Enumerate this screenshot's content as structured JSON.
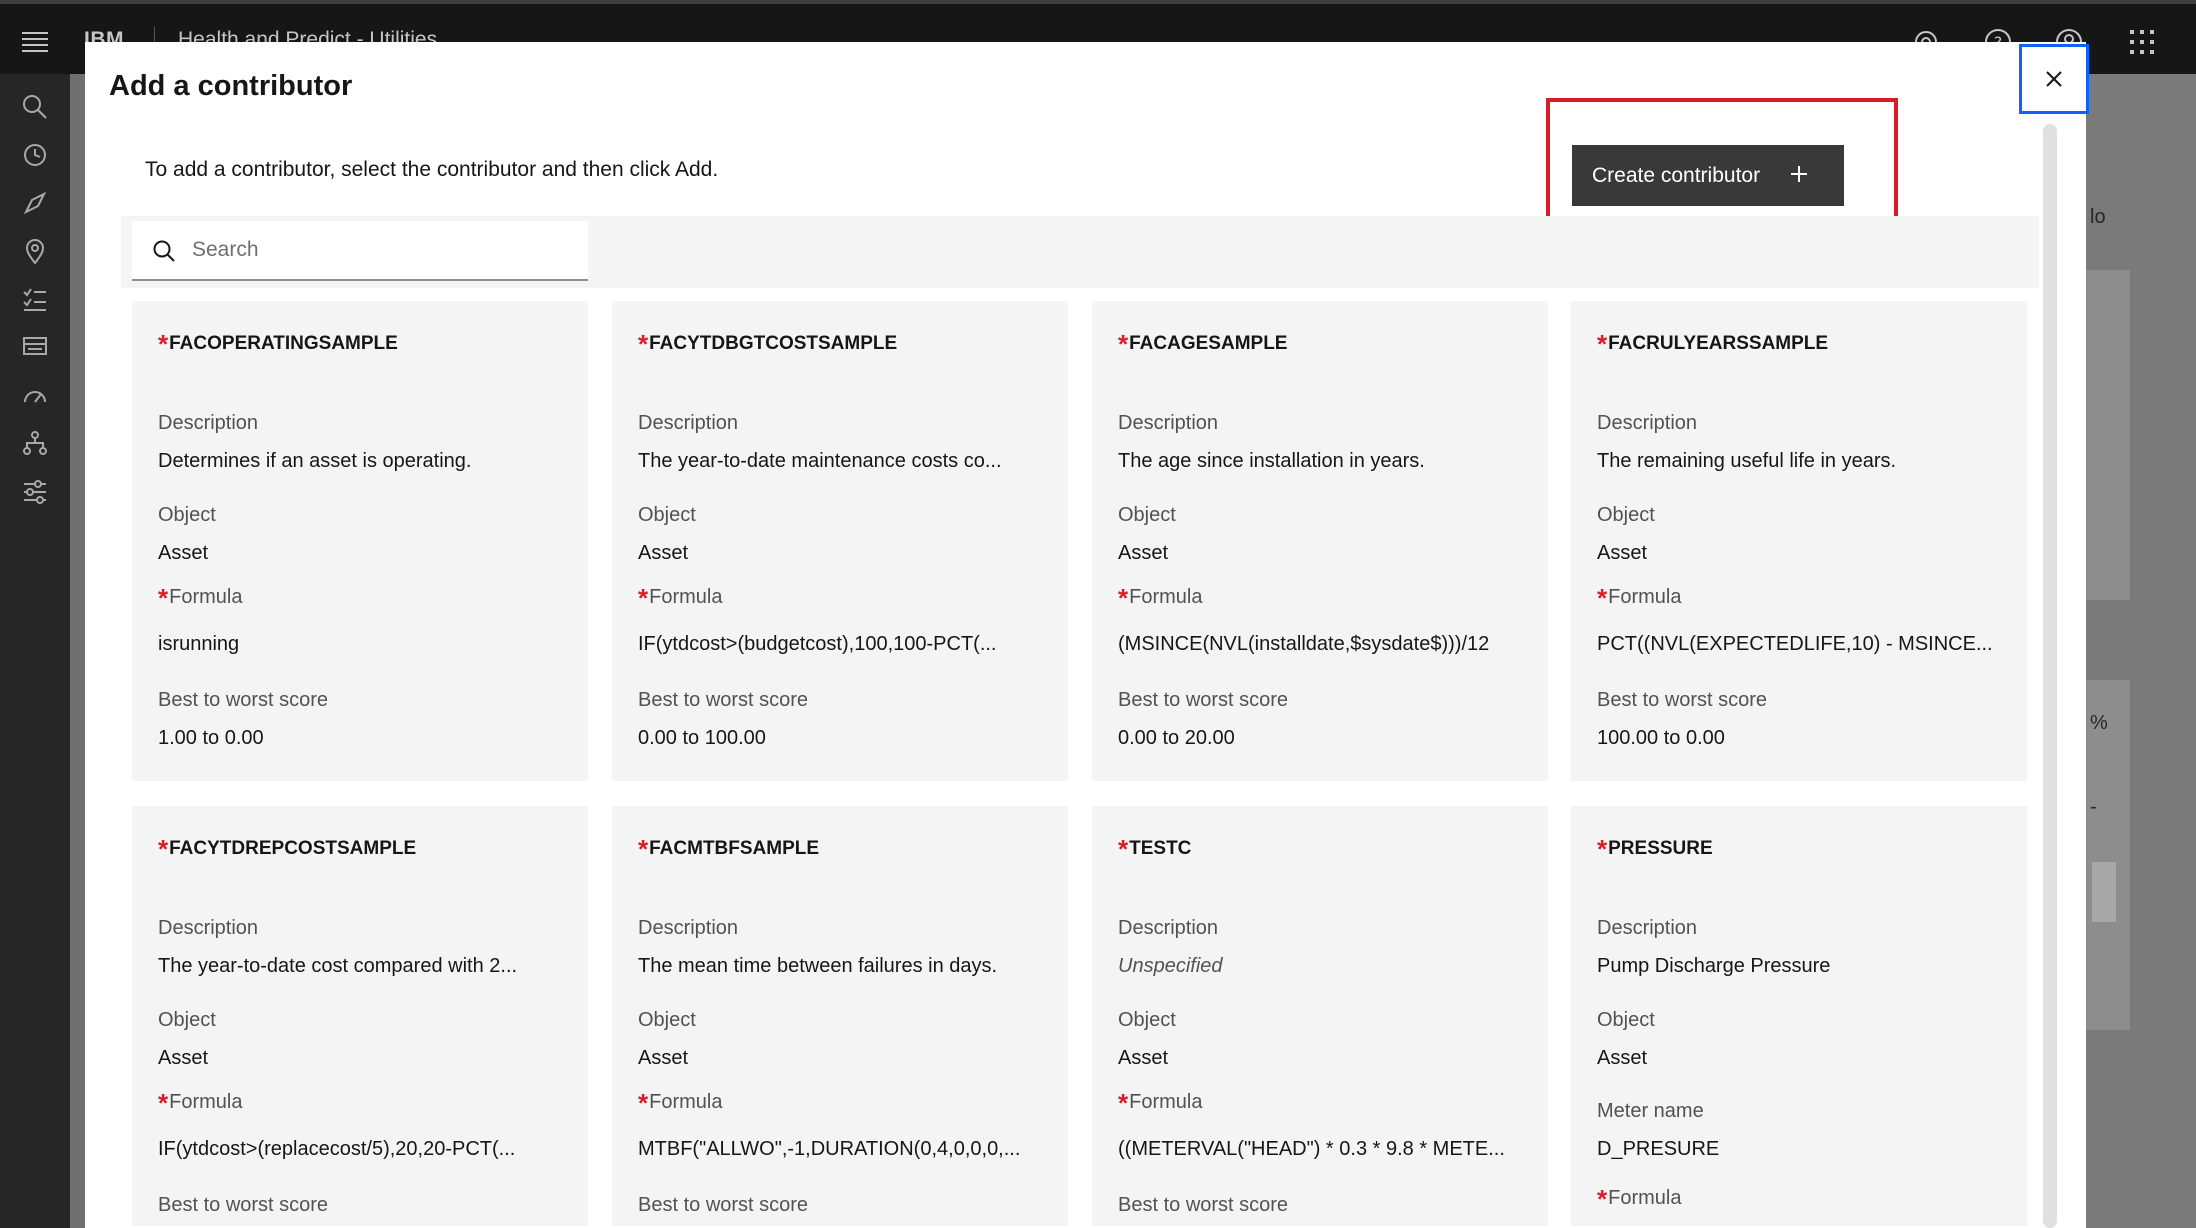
{
  "header": {
    "brand": "IBM",
    "app_name": "Health and Predict - Utilities"
  },
  "background": {
    "fragments": [
      "lo",
      "%",
      "-"
    ]
  },
  "modal": {
    "title": "Add a contributor",
    "helper_text": "To add a contributor, select the contributor and then click Add.",
    "create_button_label": "Create contributor",
    "search_placeholder": "Search",
    "search_value": ""
  },
  "labels": {
    "description": "Description",
    "object": "Object",
    "formula": "Formula",
    "score": "Best to worst score",
    "meter": "Meter name"
  },
  "cards": [
    {
      "name": "FACOPERATINGSAMPLE",
      "description": "Determines if an asset is operating.",
      "object": "Asset",
      "formula": "isrunning",
      "score": "1.00 to 0.00"
    },
    {
      "name": "FACYTDBGTCOSTSAMPLE",
      "description": "The year-to-date maintenance costs co...",
      "object": "Asset",
      "formula": "IF(ytdcost>(budgetcost),100,100-PCT(...",
      "score": "0.00 to 100.00"
    },
    {
      "name": "FACAGESAMPLE",
      "description": "The age since installation in years.",
      "object": "Asset",
      "formula": "(MSINCE(NVL(installdate,$sysdate$)))/12",
      "score": "0.00 to 20.00"
    },
    {
      "name": "FACRULYEARSSAMPLE",
      "description": "The remaining useful life in years.",
      "object": "Asset",
      "formula": "PCT((NVL(EXPECTEDLIFE,10) - MSINCE...",
      "score": "100.00 to 0.00"
    },
    {
      "name": "FACYTDREPCOSTSAMPLE",
      "description": "The year-to-date cost compared with 2...",
      "object": "Asset",
      "formula": "IF(ytdcost>(replacecost/5),20,20-PCT(...",
      "score_label_only": true
    },
    {
      "name": "FACMTBFSAMPLE",
      "description": "The mean time between failures in days.",
      "object": "Asset",
      "formula": "MTBF(\"ALLWO\",-1,DURATION(0,4,0,0,0,...",
      "score_label_only": true
    },
    {
      "name": "TESTC",
      "description": "Unspecified",
      "description_italic": true,
      "object": "Asset",
      "formula": "((METERVAL(\"HEAD\") * 0.3 * 9.8 * METE...",
      "score_label_only": true
    },
    {
      "name": "PRESSURE",
      "description": "Pump Discharge Pressure",
      "object": "Asset",
      "meter_name": "D_PRESURE",
      "formula_label_only": true
    }
  ]
}
